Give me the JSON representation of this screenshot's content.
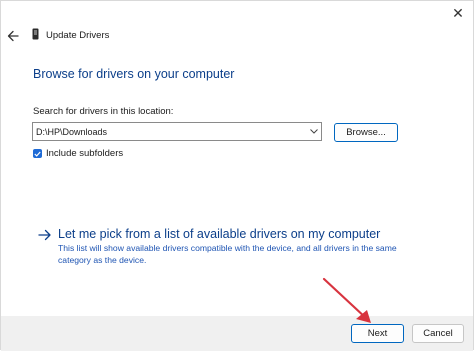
{
  "window": {
    "title": "Update Drivers",
    "close_glyph": "✕"
  },
  "browse": {
    "heading": "Browse for drivers on your computer",
    "search_label": "Search for drivers in this location:",
    "path_value": "D:\\HP\\Downloads",
    "browse_label": "Browse...",
    "include_subfolders_label": "Include subfolders",
    "include_subfolders_checked": true
  },
  "pick": {
    "link_text": "Let me pick from a list of available drivers on my computer",
    "description": "This list will show available drivers compatible with the device, and all drivers in the same category as the device."
  },
  "footer": {
    "next_label": "Next",
    "cancel_label": "Cancel"
  },
  "colors": {
    "accent": "#0067c0",
    "heading": "#0c3f8a",
    "link_desc": "#1f55b3",
    "checkbox": "#1f6bd6",
    "annotation_arrow": "#d8343f",
    "footer_bg": "#f0f0f0"
  },
  "icons": [
    "close-icon",
    "back-arrow-icon",
    "device-icon",
    "chevron-down-icon",
    "checkmark-icon",
    "right-arrow-icon"
  ]
}
